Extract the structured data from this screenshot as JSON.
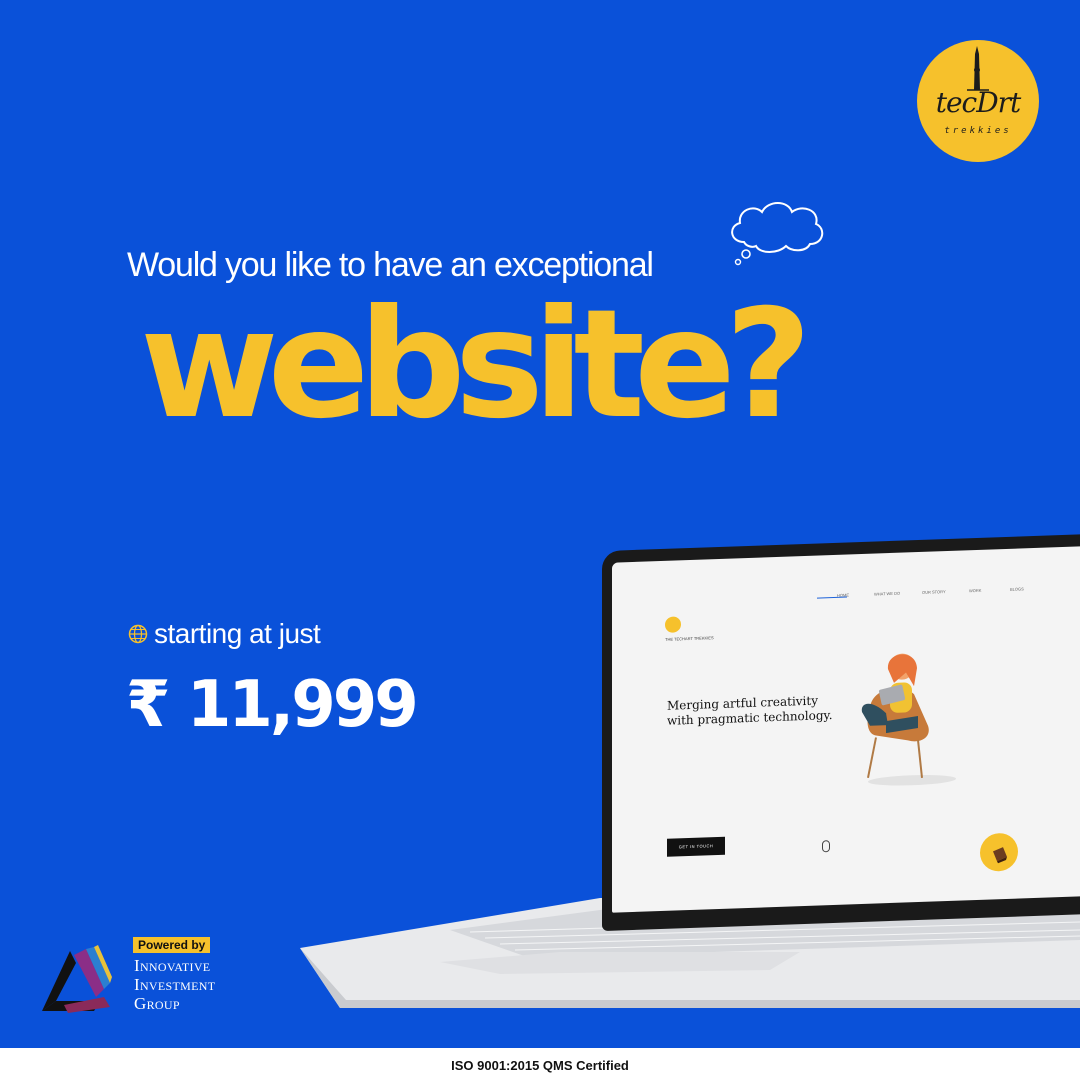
{
  "brand": {
    "logo_text": "tecDrt",
    "logo_subtext": "trekkies",
    "accent_color": "#f6c12c",
    "background_color": "#0a51d9"
  },
  "hero": {
    "headline": "Would you like to have an exceptional",
    "big_word": "website?",
    "thought_icon": "cloud-icon"
  },
  "offer": {
    "starting_label": "starting at just",
    "price": "₹ 11,999",
    "icon": "globe-icon"
  },
  "laptop_screen": {
    "nav_items": [
      "HOME",
      "WHAT WE DO",
      "OUR STORY",
      "WORK",
      "BLOGS"
    ],
    "logo_caption": "THE TECHART TREKKIES",
    "tagline": "Merging artful creativity with pragmatic technology.",
    "cta_label": "GET IN TOUCH"
  },
  "powered": {
    "label": "Powered by",
    "company_name": "Innovative\nInvestment\nGroup"
  },
  "footer": {
    "certification": "ISO 9001:2015 QMS Certified"
  }
}
